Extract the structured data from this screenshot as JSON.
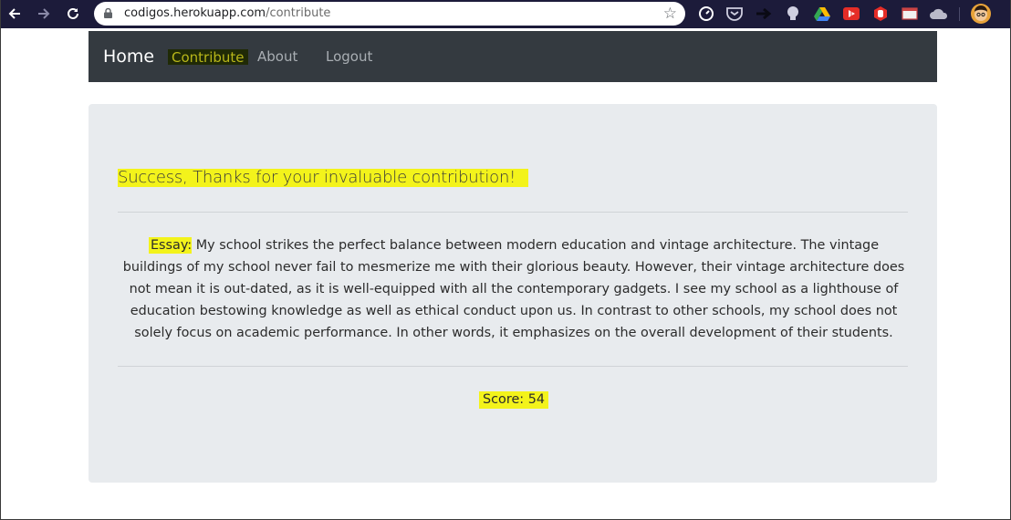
{
  "browser": {
    "url_host": "codigos.herokuapp.com",
    "url_path": "/contribute",
    "toolbar_icons": [
      "back-icon",
      "forward-icon",
      "reload-icon",
      "lock-icon",
      "bookmark-star-icon"
    ],
    "extension_icons": [
      "speedometer-extension-icon",
      "pocket-extension-icon",
      "arrow-extension-icon",
      "bulb-extension-icon",
      "google-drive-icon",
      "youtube-extension-icon",
      "hand-stop-extension-icon",
      "window-extension-icon",
      "cloud-extension-icon",
      "profile-avatar"
    ]
  },
  "navbar": {
    "brand": "Home",
    "items": [
      {
        "label": "Contribute",
        "active": true
      },
      {
        "label": "About"
      },
      {
        "label": "Logout"
      }
    ]
  },
  "main": {
    "success_message": "Success, Thanks for your invaluable contribution!",
    "essay_label": "Essay:",
    "essay_text": " My school strikes the perfect balance between modern education and vintage architecture. The vintage buildings of my school never fail to mesmerize me with their glorious beauty. However, their vintage architecture does not mean it is out-dated, as it is well-equipped with all the contemporary gadgets. I see my school as a lighthouse of education bestowing knowledge as well as ethical conduct upon us. In contrast to other schools, my school does not solely focus on academic performance. In other words, it emphasizes on the overall development of their students.",
    "score_text": "Score: 54"
  },
  "colors": {
    "highlight": "#f3f31b",
    "navbar_bg": "#343a40",
    "jumbotron_bg": "#e8ebee",
    "chrome_bg": "#1c1b3a"
  }
}
